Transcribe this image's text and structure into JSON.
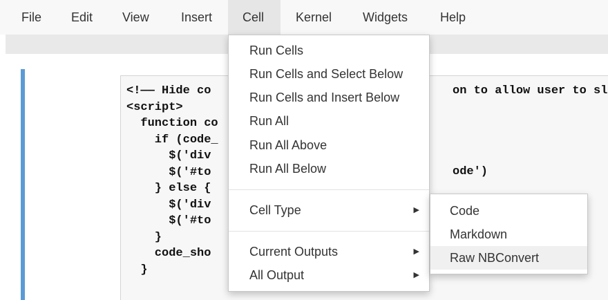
{
  "menubar": {
    "items": [
      "File",
      "Edit",
      "View",
      "Insert",
      "Cell",
      "Kernel",
      "Widgets",
      "Help"
    ],
    "active": "Cell"
  },
  "code": {
    "lines": [
      "<!—— Hide co",
      "<script>",
      "  function co",
      "    if (code_",
      "      $('div",
      "      $('#to",
      "    } else {",
      "      $('div",
      "      $('#to",
      "    }",
      "    code_sho",
      "  }"
    ],
    "right_fragments": [
      "on to allow user to sl",
      "ode')"
    ]
  },
  "cell_menu": {
    "items": [
      "Run Cells",
      "Run Cells and Select Below",
      "Run Cells and Insert Below",
      "Run All",
      "Run All Above",
      "Run All Below"
    ],
    "cell_type": "Cell Type",
    "current_outputs": "Current Outputs",
    "all_output": "All Output",
    "submenu_caret": "▶"
  },
  "cell_type_submenu": {
    "items": [
      "Code",
      "Markdown",
      "Raw NBConvert"
    ],
    "highlighted": "Raw NBConvert"
  },
  "colors": {
    "cell_selected_bar": "#5a9bd5",
    "menubar_bg": "#f8f8f8",
    "open_menu_bg": "#e6e6e6"
  }
}
